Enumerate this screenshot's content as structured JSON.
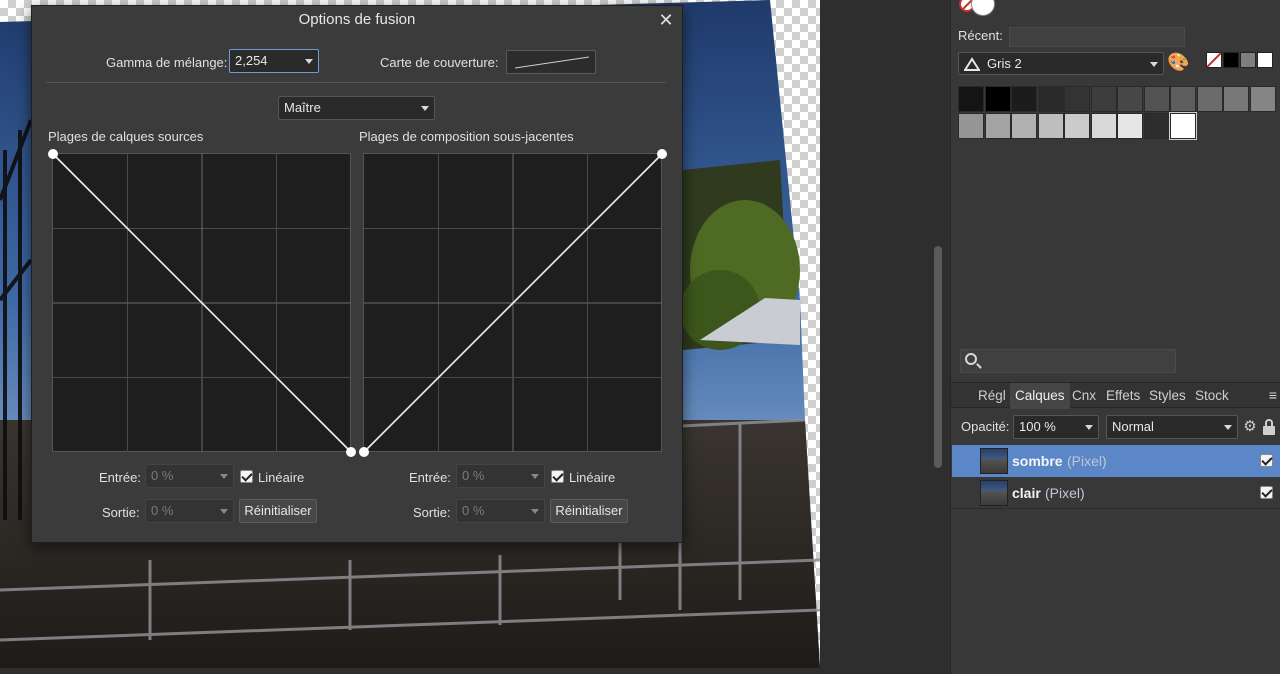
{
  "dialog": {
    "title": "Options de fusion",
    "close_glyph": "✕",
    "gamma_label": "Gamma de mélange:",
    "gamma_value": "2,254",
    "coverage_label": "Carte de couverture:",
    "channel_value": "Maître",
    "source_title": "Plages de calques sources",
    "underlying_title": "Plages de composition sous-jacentes",
    "source_curve": [
      [
        0,
        1
      ],
      [
        1,
        0
      ]
    ],
    "underlying_curve": [
      [
        0,
        0
      ],
      [
        1,
        1
      ]
    ],
    "left": {
      "input_label": "Entrée:",
      "input_value": "0 %",
      "output_label": "Sortie:",
      "output_value": "0 %",
      "linear_label": "Linéaire",
      "linear_checked": true,
      "reset_label": "Réinitialiser"
    },
    "right": {
      "input_label": "Entrée:",
      "input_value": "0 %",
      "output_label": "Sortie:",
      "output_value": "0 %",
      "linear_label": "Linéaire",
      "linear_checked": true,
      "reset_label": "Réinitialiser"
    }
  },
  "swatches_panel": {
    "recent_label": "Récent:",
    "palette_name": "Gris 2",
    "palette_icon": "palette-icon",
    "gray_row_1": [
      "#141414",
      "#000000",
      "#1c1c1c",
      "#2a2a2a",
      "#333333",
      "#3d3d3d",
      "#474747",
      "#525252",
      "#5e5e5e",
      "#6b6b6b",
      "#787878",
      "#858585"
    ],
    "gray_row_2": [
      "#959595",
      "#a3a3a3",
      "#b0b0b0",
      "#bebebe",
      "#cbcbcb",
      "#d9d9d9",
      "#e6e6e6",
      "#2d2d2d",
      "#ffffff"
    ]
  },
  "layers_panel": {
    "tabs": [
      "Régl",
      "Calques",
      "Cnx",
      "Effets",
      "Styles",
      "Stock"
    ],
    "active_tab": "Calques",
    "opacity_label": "Opacité:",
    "opacity_value": "100 %",
    "blend_mode": "Normal",
    "layers": [
      {
        "name": "sombre",
        "type": "(Pixel)",
        "selected": true,
        "visible": true
      },
      {
        "name": "clair",
        "type": "(Pixel)",
        "selected": false,
        "visible": true
      }
    ]
  }
}
